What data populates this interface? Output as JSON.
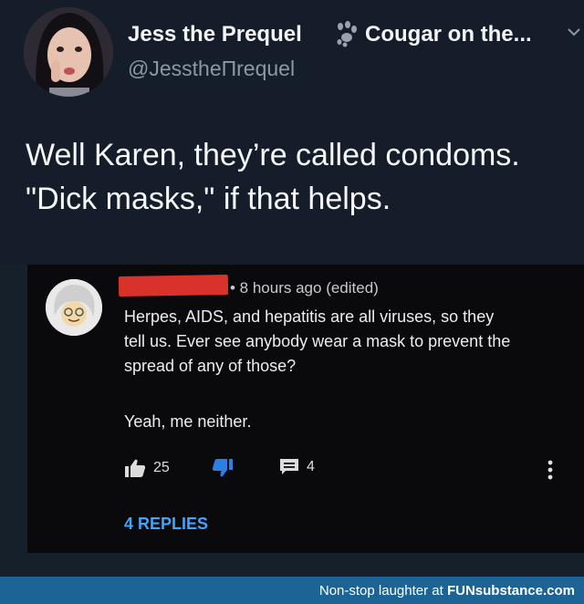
{
  "tweet": {
    "author_name": "Jess the Prequel",
    "author_bio": "Cougar on the...",
    "handle": "@JesstheПrequel",
    "text_lines": [
      "Well Karen, they’re called condoms.",
      "\"Dick masks,\" if that helps."
    ],
    "icons": [
      "paw-print-icon",
      "chevron-down-icon"
    ]
  },
  "comment": {
    "meta": "• 8 hours ago (edited)",
    "body_lines": [
      "Herpes, AIDS, and hepatitis are all viruses, so they",
      "tell us. Ever see anybody wear a mask to prevent the",
      "spread of any of those?"
    ],
    "reply_text": "Yeah, me neither.",
    "likes": "25",
    "replies_count": "4",
    "replies_link": "4 REPLIES",
    "colors": {
      "redaction": "#d8322b",
      "link": "#3ea6ff",
      "dislike_icon": "#2f7fe0"
    }
  },
  "footer": {
    "prefix": "Non-stop laughter at ",
    "brand": "FUNsubstance.com"
  }
}
